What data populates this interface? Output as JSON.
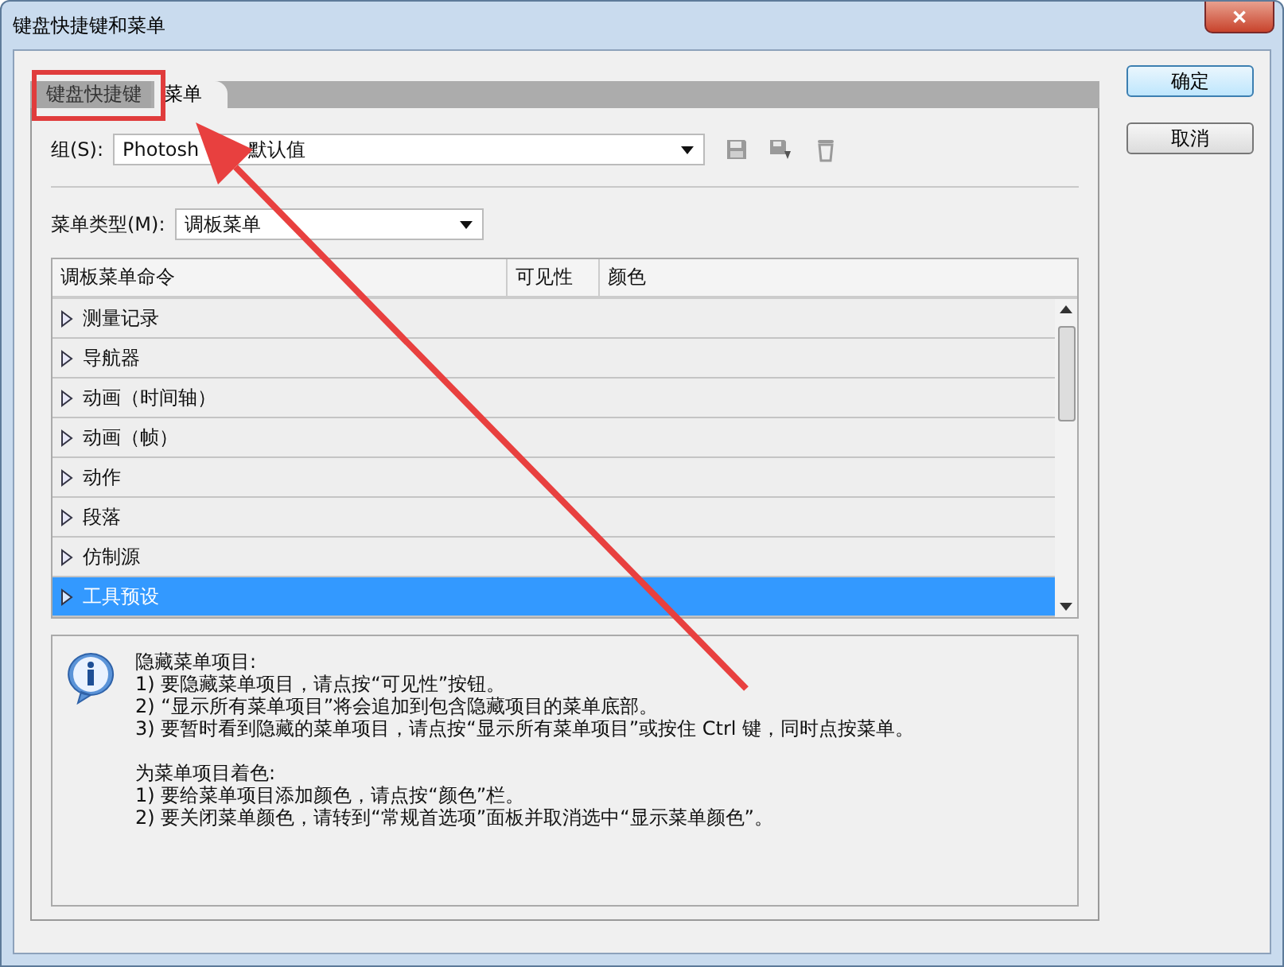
{
  "window": {
    "title": "键盘快捷键和菜单",
    "close": "✕"
  },
  "tabs": [
    {
      "label": "键盘快捷键",
      "selected": false
    },
    {
      "label": "菜单",
      "selected": true
    }
  ],
  "group": {
    "label": "组(S):",
    "value_parts": [
      "Photosh",
      "默认值"
    ]
  },
  "menu_type": {
    "label": "菜单类型(M):",
    "value": "调板菜单"
  },
  "table": {
    "columns": [
      "调板菜单命令",
      "可见性",
      "颜色"
    ],
    "rows": [
      {
        "label": "测量记录",
        "selected": false
      },
      {
        "label": "导航器",
        "selected": false
      },
      {
        "label": "动画（时间轴）",
        "selected": false
      },
      {
        "label": "动画（帧）",
        "selected": false
      },
      {
        "label": "动作",
        "selected": false
      },
      {
        "label": "段落",
        "selected": false
      },
      {
        "label": "仿制源",
        "selected": false
      },
      {
        "label": "工具预设",
        "selected": true
      }
    ]
  },
  "info": {
    "sections": [
      {
        "title": "隐藏菜单项目:",
        "lines": [
          "1) 要隐藏菜单项目，请点按“可见性”按钮。",
          "2) “显示所有菜单项目”将会追加到包含隐藏项目的菜单底部。",
          "3) 要暂时看到隐藏的菜单项目，请点按“显示所有菜单项目”或按住 Ctrl 键，同时点按菜单。"
        ]
      },
      {
        "title": "为菜单项目着色:",
        "lines": [
          "1) 要给菜单项目添加颜色，请点按“颜色”栏。",
          "2) 要关闭菜单颜色，请转到“常规首选项”面板并取消选中“显示菜单颜色”。"
        ]
      }
    ]
  },
  "buttons": [
    {
      "label": "确定",
      "default": true
    },
    {
      "label": "取消",
      "default": false
    }
  ]
}
